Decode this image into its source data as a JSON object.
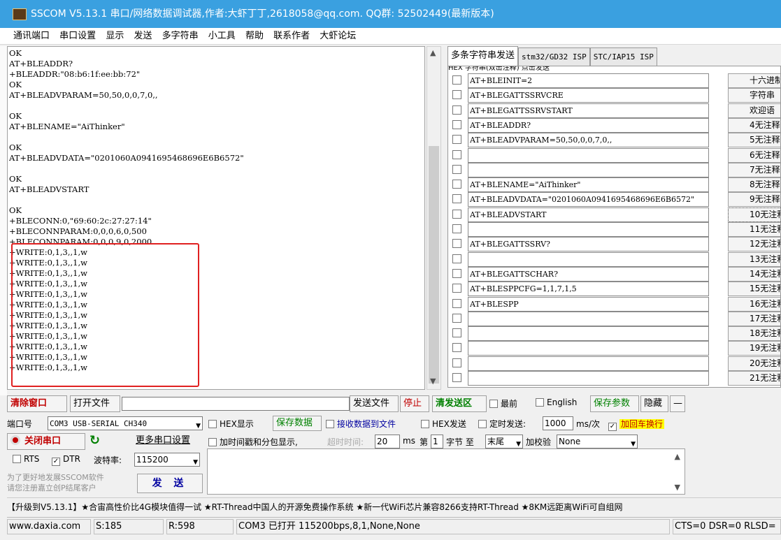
{
  "window": {
    "title": "SSCOM V5.13.1 串口/网络数据调试器,作者:大虾丁丁,2618058@qq.com. QQ群: 52502449(最新版本)"
  },
  "menu": [
    "通讯端口",
    "串口设置",
    "显示",
    "发送",
    "多字符串",
    "小工具",
    "帮助",
    "联系作者",
    "大虾论坛"
  ],
  "receive": {
    "lines": [
      "OK",
      "AT+BLEADDR?",
      "+BLEADDR:\"08:b6:1f:ee:bb:72\"",
      "OK",
      "AT+BLEADVPARAM=50,50,0,0,7,0,,",
      "",
      "OK",
      "AT+BLENAME=\"AiThinker\"",
      "",
      "OK",
      "AT+BLEADVDATA=\"0201060A0941695468696E6B6572\"",
      "",
      "OK",
      "AT+BLEADVSTART",
      "",
      "OK",
      "+BLECONN:0,\"69:60:2c:27:27:14\"",
      "+BLECONNPARAM:0,0,0,6,0,500",
      "+BLECONNPARAM:0,0,0,9,0,2000",
      "+WRITE:0,1,3,,1,w",
      "+WRITE:0,1,3,,1,w",
      "+WRITE:0,1,3,,1,w",
      "+WRITE:0,1,3,,1,w",
      "+WRITE:0,1,3,,1,w",
      "+WRITE:0,1,3,,1,w",
      "+WRITE:0,1,3,,1,w",
      "+WRITE:0,1,3,,1,w",
      "+WRITE:0,1,3,,1,w",
      "+WRITE:0,1,3,,1,w",
      "+WRITE:0,1,3,,1,w",
      "+WRITE:0,1,3,,1,w"
    ]
  },
  "tabs": [
    "多条字符串发送",
    "stm32/GD32 ISP",
    "STC/IAP15 ISP"
  ],
  "multi": {
    "header": "HEX 字符串(双击注释)                                                    点击发送",
    "rows": [
      {
        "text": "AT+BLEINIT=2",
        "button": "十六进制数"
      },
      {
        "text": "AT+BLEGATTSSRVCRE",
        "button": "字符串"
      },
      {
        "text": "AT+BLEGATTSSRVSTART",
        "button": "欢迎语"
      },
      {
        "text": "AT+BLEADDR?",
        "button": "4无注释"
      },
      {
        "text": "AT+BLEADVPARAM=50,50,0,0,7,0,,",
        "button": "5无注释"
      },
      {
        "text": "",
        "button": "6无注释"
      },
      {
        "text": "",
        "button": "7无注释"
      },
      {
        "text": "AT+BLENAME=\"AiThinker\"",
        "button": "8无注释"
      },
      {
        "text": "AT+BLEADVDATA=\"0201060A0941695468696E6B6572\"",
        "button": "9无注释"
      },
      {
        "text": "AT+BLEADVSTART",
        "button": "10无注释"
      },
      {
        "text": "",
        "button": "11无注释"
      },
      {
        "text": "AT+BLEGATTSSRV?",
        "button": "12无注释"
      },
      {
        "text": "",
        "button": "13无注释"
      },
      {
        "text": "AT+BLEGATTSCHAR?",
        "button": "14无注释"
      },
      {
        "text": "AT+BLESPPCFG=1,1,7,1,5",
        "button": "15无注释"
      },
      {
        "text": "AT+BLESPP",
        "button": "16无注释"
      },
      {
        "text": "",
        "button": "17无注释"
      },
      {
        "text": "",
        "button": "18无注释"
      },
      {
        "text": "",
        "button": "19无注释"
      },
      {
        "text": "",
        "button": "20无注释"
      },
      {
        "text": "",
        "button": "21无注释"
      }
    ]
  },
  "toolbar": {
    "clear": "清除窗口",
    "open_file": "打开文件",
    "send_file": "发送文件",
    "stop": "停止",
    "clear_send": "清发送区",
    "top_most": "最前",
    "english": "English",
    "save_params": "保存参数",
    "hide": "隐藏",
    "minus": "—"
  },
  "row2": {
    "port_label": "端口号",
    "port_value": "COM3 USB-SERIAL CH340",
    "hex_display": "HEX显示",
    "save_data": "保存数据",
    "recv_to_file": "接收数据到文件",
    "hex_send": "HEX发送",
    "timed_send": "定时发送:",
    "interval": "1000",
    "unit": "ms/次",
    "add_crlf": "加回车换行"
  },
  "row3": {
    "close_port": "关闭串口",
    "more_settings": "更多串口设置",
    "timestamp": "加时间戳和分包显示,",
    "timeout_label": "超时时间:",
    "timeout_value": "20",
    "ms": "ms",
    "page_label": "第",
    "byte_value": "1",
    "byte_label": "字节 至",
    "end_value": "末尾",
    "checksum_label": "加校验",
    "checksum_value": "None"
  },
  "row4": {
    "rts": "RTS",
    "dtr": "DTR",
    "baud_label": "波特率:",
    "baud_value": "115200"
  },
  "promo": {
    "line1": "为了更好地发展SSCOM软件",
    "line2": "请您注册嘉立创P结尾客户"
  },
  "send_button": "发 送",
  "news": "【升级到V5.13.1】★合宙高性价比4G模块值得一试 ★RT-Thread中国人的开源免费操作系统 ★新一代WiFi芯片兼容8266支持RT-Thread ★8KM远距离WiFi可自组网",
  "status": {
    "site": "www.daxia.com",
    "sent": "S:185",
    "received": "R:598",
    "port_state": "COM3 已打开  115200bps,8,1,None,None",
    "lines": "CTS=0 DSR=0 RLSD="
  },
  "colors": {
    "titlebar": "#3aa0e0",
    "highlight_box": "#e02020",
    "crlf_highlight": "#ffff00"
  }
}
